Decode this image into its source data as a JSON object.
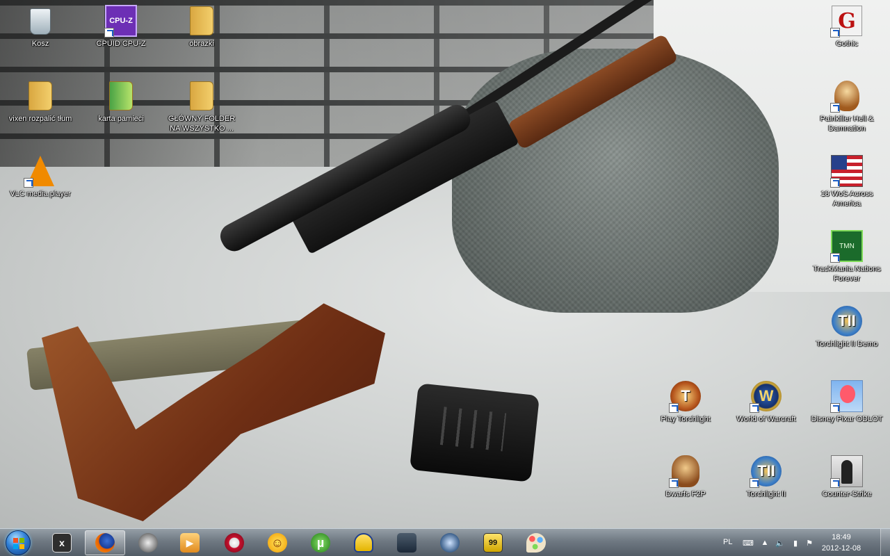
{
  "desktop": {
    "icons": [
      {
        "id": "recycle-bin",
        "label": "Kosz"
      },
      {
        "id": "cpuz",
        "label": "CPUID CPU-Z",
        "glyph": "CPU-Z"
      },
      {
        "id": "obrazki",
        "label": "obrazki"
      },
      {
        "id": "vixen",
        "label": "vixen rozpalić tłum"
      },
      {
        "id": "karta",
        "label": "karta pamieci"
      },
      {
        "id": "glowny",
        "label": "GŁÓWNY FOLDER NA WSZYSTKO ..."
      },
      {
        "id": "vlc",
        "label": "VLC media player"
      },
      {
        "id": "gothic",
        "label": "Gothic",
        "glyph": "G"
      },
      {
        "id": "painkiller",
        "label": "Painkiller Hell & Damnation"
      },
      {
        "id": "wos",
        "label": "18 WoS Across America"
      },
      {
        "id": "trackmania",
        "label": "TrackMania Nations Forever",
        "glyph": "TMN"
      },
      {
        "id": "torchlight2demo",
        "label": "Torchlight II Demo",
        "glyph": "TII"
      },
      {
        "id": "playtorchlight",
        "label": "Play Torchlight",
        "glyph": "T"
      },
      {
        "id": "wow",
        "label": "World of Warcraft",
        "glyph": "W"
      },
      {
        "id": "odlot",
        "label": "Disney Pixar ODLOT"
      },
      {
        "id": "dwarfs",
        "label": "Dwarfs F2P"
      },
      {
        "id": "torchlight2",
        "label": "Torchlight II",
        "glyph": "TII"
      },
      {
        "id": "cs",
        "label": "Counter-Strike"
      }
    ]
  },
  "taskbar": {
    "apps": [
      {
        "name": "xfire",
        "glyph": "x",
        "color": "#3a3a3a"
      },
      {
        "name": "firefox",
        "glyph": "",
        "color": "#e66000"
      },
      {
        "name": "movie-maker",
        "glyph": "",
        "color": "#6b4a2a"
      },
      {
        "name": "media-player",
        "glyph": "▶",
        "color": "#e08a1e"
      },
      {
        "name": "nero",
        "glyph": "",
        "color": "#c8102e"
      },
      {
        "name": "sun-app",
        "glyph": "☺",
        "color": "#f2b400"
      },
      {
        "name": "utorrent",
        "glyph": "µ",
        "color": "#3f9a2e"
      },
      {
        "name": "audio-headphones",
        "glyph": "",
        "color": "#e3b400"
      },
      {
        "name": "steam",
        "glyph": "",
        "color": "#2a3a4a"
      },
      {
        "name": "teamspeak",
        "glyph": "",
        "color": "#3b5f8a"
      },
      {
        "name": "monitor-99",
        "glyph": "99",
        "color": "#4b4b4b"
      },
      {
        "name": "paint",
        "glyph": "",
        "color": "#8a6bb0"
      }
    ],
    "tray": {
      "language": "PL",
      "time": "18:49",
      "date": "2012-12-08"
    }
  }
}
